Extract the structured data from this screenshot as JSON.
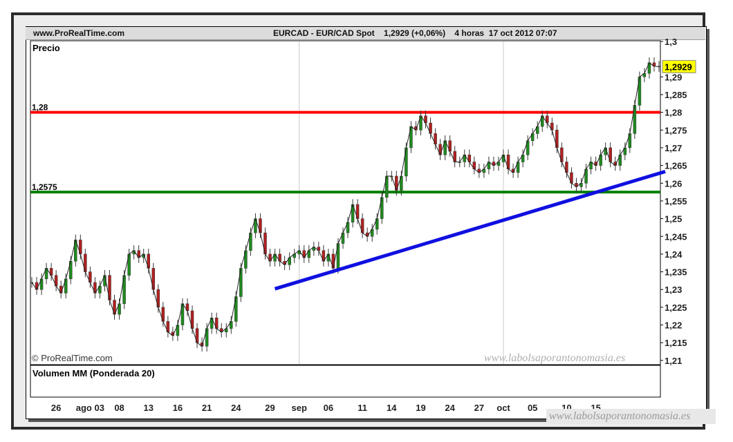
{
  "site": "www.ProRealTime.com",
  "header": {
    "symbol": "EURCAD - EUR/CAD Spot",
    "price_change": "1,2929 (+0,06%)",
    "timeframe": "4 horas",
    "datetime": "17 oct 2012 07:07"
  },
  "copyright": "© ProRealTime.com",
  "watermark": "www.labolsaporantonomasia.es",
  "chart_data": [
    {
      "type": "line",
      "title": "Precio",
      "y_ticks": [
        1.21,
        1.215,
        1.22,
        1.225,
        1.23,
        1.235,
        1.24,
        1.245,
        1.25,
        1.255,
        1.26,
        1.265,
        1.27,
        1.275,
        1.28,
        1.285,
        1.29,
        1.3
      ],
      "y_tick_labels": [
        "1,21",
        "1,215",
        "1,22",
        "1,225",
        "1,23",
        "1,235",
        "1,24",
        "1,245",
        "1,25",
        "1,255",
        "1,26",
        "1,265",
        "1,27",
        "1,275",
        "1,28",
        "1,285",
        "1,29",
        "1,3"
      ],
      "ylim": [
        1.209,
        1.3
      ],
      "x_ticks": [
        "26",
        "ago 03",
        "08",
        "13",
        "16",
        "21",
        "24",
        "29",
        "sep",
        "06",
        "11",
        "14",
        "19",
        "24",
        "27",
        "oct",
        "05",
        "10",
        "15"
      ],
      "x_tick_index": [
        5,
        12,
        18,
        24,
        30,
        36,
        42,
        49,
        55,
        61,
        68,
        74,
        80,
        86,
        92,
        97,
        103,
        110,
        116
      ],
      "x_count": 130,
      "current_price": 1.2929,
      "current_price_label": "1,2929",
      "levels": [
        {
          "label": "1,28",
          "value": 1.28,
          "color": "#ff0000"
        },
        {
          "label": "1,2575",
          "value": 1.2575,
          "color": "#008000"
        }
      ],
      "trendline": {
        "color": "#1010e0",
        "points": [
          [
            50,
            1.2302
          ],
          [
            130,
            1.2633
          ]
        ]
      },
      "series": [
        {
          "values": [
            1.232,
            1.23,
            1.233,
            1.236,
            1.234,
            1.231,
            1.229,
            1.233,
            1.238,
            1.244,
            1.24,
            1.235,
            1.232,
            1.229,
            1.231,
            1.234,
            1.227,
            1.223,
            1.226,
            1.234,
            1.24,
            1.241,
            1.239,
            1.24,
            1.236,
            1.23,
            1.225,
            1.221,
            1.218,
            1.217,
            1.22,
            1.226,
            1.224,
            1.219,
            1.215,
            1.214,
            1.219,
            1.222,
            1.219,
            1.218,
            1.219,
            1.221,
            1.228,
            1.236,
            1.241,
            1.246,
            1.25,
            1.246,
            1.24,
            1.238,
            1.24,
            1.238,
            1.237,
            1.239,
            1.24,
            1.241,
            1.239,
            1.241,
            1.242,
            1.241,
            1.238,
            1.24,
            1.236,
            1.243,
            1.246,
            1.249,
            1.254,
            1.25,
            1.246,
            1.245,
            1.247,
            1.25,
            1.256,
            1.262,
            1.262,
            1.258,
            1.262,
            1.27,
            1.276,
            1.275,
            1.279,
            1.277,
            1.274,
            1.271,
            1.268,
            1.272,
            1.269,
            1.266,
            1.266,
            1.268,
            1.266,
            1.264,
            1.263,
            1.264,
            1.266,
            1.265,
            1.266,
            1.268,
            1.264,
            1.263,
            1.266,
            1.268,
            1.272,
            1.274,
            1.276,
            1.279,
            1.277,
            1.275,
            1.27,
            1.266,
            1.263,
            1.26,
            1.259,
            1.26,
            1.264,
            1.266,
            1.265,
            1.268,
            1.27,
            1.266,
            1.265,
            1.268,
            1.27,
            1.274,
            1.282,
            1.29,
            1.291,
            1.294,
            1.293,
            1.2929
          ]
        }
      ]
    },
    {
      "type": "bar",
      "title": "Volumen MM (Ponderada 20)",
      "values": []
    }
  ]
}
